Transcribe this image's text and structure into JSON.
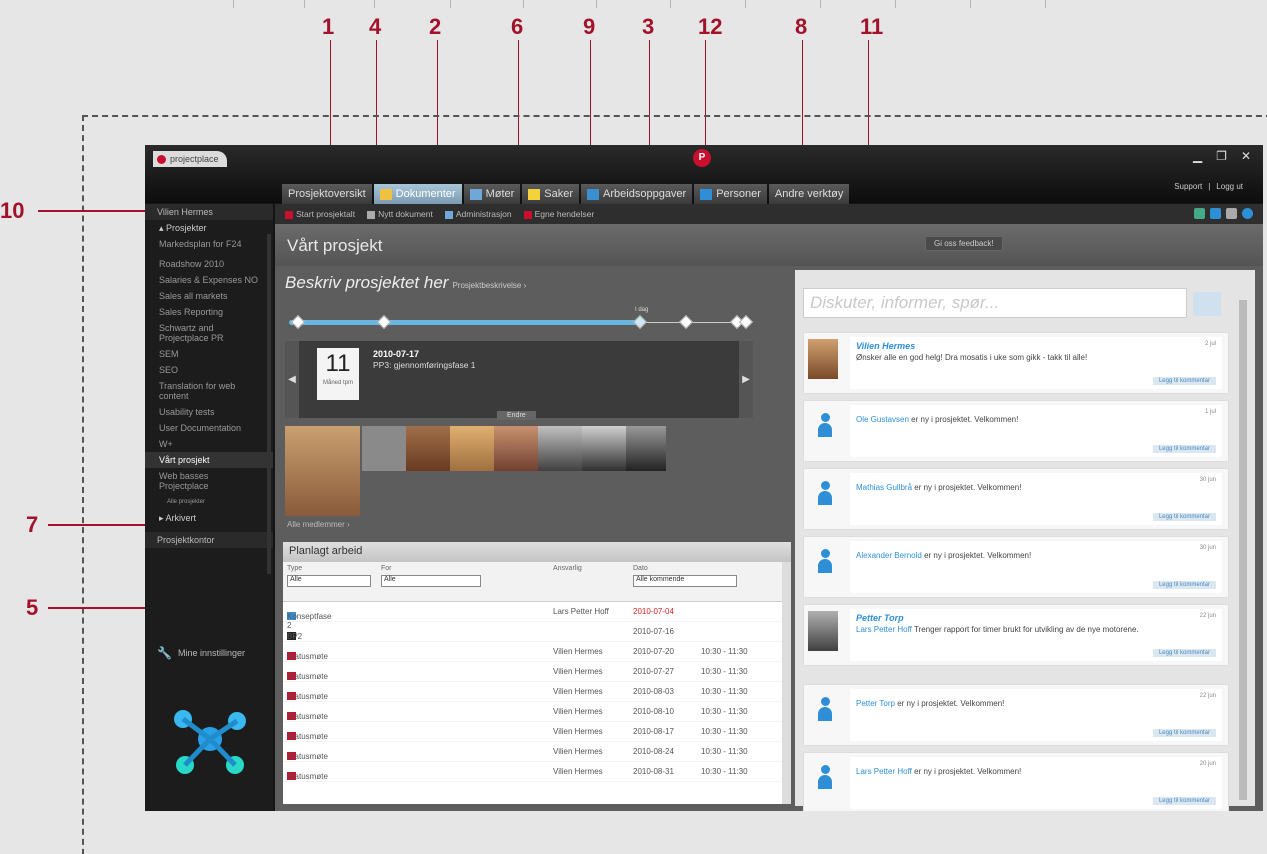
{
  "callouts_top": [
    "1",
    "4",
    "2",
    "6",
    "9",
    "3",
    "12",
    "8",
    "11"
  ],
  "callouts_left": [
    "10",
    "7",
    "5"
  ],
  "app": {
    "logo": "projectplace",
    "support": "Support",
    "logout": "Logg ut",
    "close": "✕",
    "minimize": "▁",
    "restore": "❐"
  },
  "tabs": [
    "Prosjektoversikt",
    "Dokumenter",
    "Møter",
    "Saker",
    "Arbeidsoppgaver",
    "Personer",
    "Andre verktøy"
  ],
  "sidebar": {
    "user": "Vilien Hermes",
    "projects_header": "▴ Prosjekter",
    "items": [
      "Markedsplan for F24",
      "Roadshow 2010",
      "Salaries & Expenses NO",
      "Sales all markets",
      "Sales Reporting",
      "Schwartz and Projectplace PR",
      "SEM",
      "SEO",
      "Translation for web content",
      "Usability tests",
      "User Documentation",
      "W+",
      "Vårt prosjekt",
      "Web basses Projectplace"
    ],
    "show_all": "Alle prosjekter",
    "archived": "▸ Arkivert",
    "office": "Prosjektkontor",
    "settings": "Mine innstillinger"
  },
  "toolbar": {
    "items": [
      "Start prosjektalt",
      "Nytt dokument",
      "Administrasjon",
      "Egne hendelser"
    ]
  },
  "project": {
    "title": "Vårt prosjekt",
    "feedback": "Gi oss feedback!",
    "describe": "Beskriv prosjektet her",
    "describe_link": "Prosjektbeskrivelse ›",
    "timeline_label": "I dag",
    "timeline_progress": 0.77,
    "milestone": {
      "day": "11",
      "month": "Måned tpm",
      "date": "2010-07-17",
      "text": "PP3: gjennomføringsfase 1",
      "edit": "Endre"
    },
    "all_members": "Alle medlemmer ›"
  },
  "planned": {
    "title": "Planlagt arbeid",
    "filters": {
      "type_label": "Type",
      "type_value": "Alle",
      "for_label": "For",
      "for_value": "Alle",
      "resp_label": "Ansvarlig",
      "date_label": "Dato",
      "date_value": "Alle kommende"
    },
    "rows": [
      {
        "name": "Konseptfase 2",
        "resp": "Lars Petter Hoff",
        "date": "2010-07-04",
        "time": "",
        "late": true
      },
      {
        "name": "BP2",
        "resp": "",
        "date": "2010-07-16",
        "time": "",
        "late": false
      },
      {
        "name": "Statusmøte",
        "resp": "Vilien Hermes",
        "date": "2010-07-20",
        "time": "10:30 - 11:30",
        "late": false
      },
      {
        "name": "Statusmøte",
        "resp": "Vilien Hermes",
        "date": "2010-07-27",
        "time": "10:30 - 11:30",
        "late": false
      },
      {
        "name": "Statusmøte",
        "resp": "Vilien Hermes",
        "date": "2010-08-03",
        "time": "10:30 - 11:30",
        "late": false
      },
      {
        "name": "Statusmøte",
        "resp": "Vilien Hermes",
        "date": "2010-08-10",
        "time": "10:30 - 11:30",
        "late": false
      },
      {
        "name": "Statusmøte",
        "resp": "Vilien Hermes",
        "date": "2010-08-17",
        "time": "10:30 - 11:30",
        "late": false
      },
      {
        "name": "Statusmøte",
        "resp": "Vilien Hermes",
        "date": "2010-08-24",
        "time": "10:30 - 11:30",
        "late": false
      },
      {
        "name": "Statusmøte",
        "resp": "Vilien Hermes",
        "date": "2010-08-31",
        "time": "10:30 - 11:30",
        "late": false
      }
    ]
  },
  "feed": {
    "placeholder": "Diskuter, informer, spør...",
    "comment_label": "Legg til kommentar",
    "posts": [
      {
        "name": "Vilien Hermes",
        "link": "",
        "text": "Ønsker alle en god helg! Dra mosatis i uke som gikk - takk til alle!",
        "time": "2 jul"
      },
      {
        "name": "",
        "link": "Ole Gustavsen",
        "text": "er ny i prosjektet. Velkommen!",
        "time": "1 jul"
      },
      {
        "name": "",
        "link": "Mathias Gullbrå",
        "text": "er ny i prosjektet. Velkommen!",
        "time": "30 jun"
      },
      {
        "name": "",
        "link": "Alexander Bernold",
        "text": "er ny i prosjektet. Velkommen!",
        "time": "30 jun"
      },
      {
        "name": "Petter Torp",
        "link": "Lars Petter Hoff",
        "text": "Trenger rapport for timer brukt for utvikling av de nye motorene.",
        "time": "22 jun"
      },
      {
        "name": "",
        "link": "Petter Torp",
        "text": "er ny i prosjektet. Velkommen!",
        "time": "22 jun"
      },
      {
        "name": "",
        "link": "Lars Petter Hoff",
        "text": "er ny i prosjektet. Velkommen!",
        "time": "20 jun"
      }
    ]
  }
}
